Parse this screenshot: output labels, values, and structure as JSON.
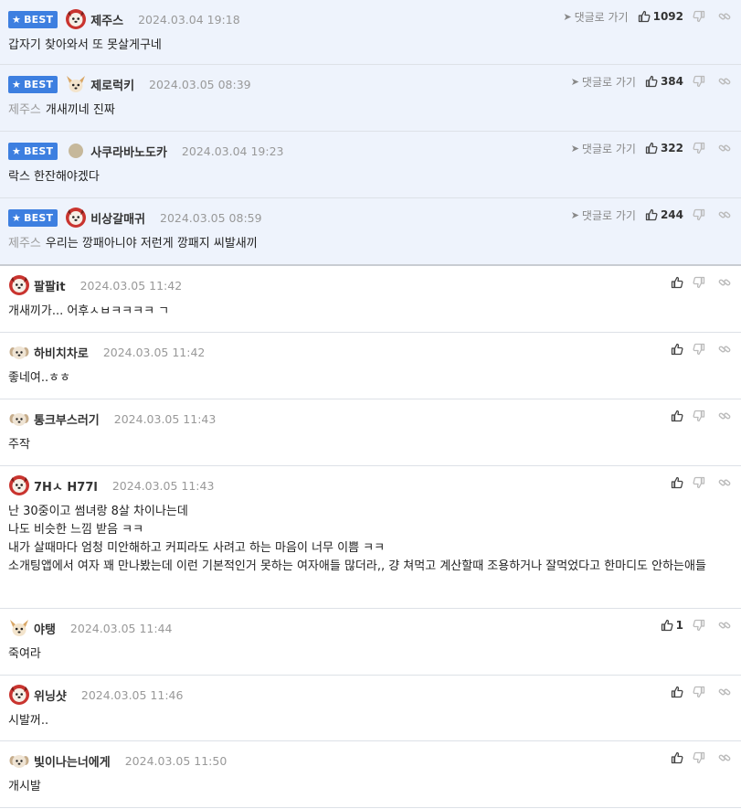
{
  "badge_label": "BEST",
  "reply_label": "댓글로 가기",
  "accent_color": "#3d7fe0",
  "comments": [
    {
      "best": true,
      "nick": "제주스",
      "date": "2024.03.04 19:18",
      "likes": "1092",
      "mention": "",
      "lines": [
        "갑자기 찾아와서 또 못살게구네"
      ],
      "avatar": "red-dog"
    },
    {
      "best": true,
      "nick": "제로럭키",
      "date": "2024.03.05 08:39",
      "likes": "384",
      "mention": "제주스",
      "lines": [
        "개새끼네 진짜"
      ],
      "avatar": "chihuahua"
    },
    {
      "best": true,
      "nick": "사쿠라바노도카",
      "date": "2024.03.04 19:23",
      "likes": "322",
      "mention": "",
      "lines": [
        "락스 한잔해야겠다"
      ],
      "avatar": "dot"
    },
    {
      "best": true,
      "nick": "비상갈매귀",
      "date": "2024.03.05 08:59",
      "likes": "244",
      "mention": "제주스",
      "lines": [
        "우리는 깡패아니야 저런게 깡패지 씨발새끼"
      ],
      "avatar": "red-dog"
    },
    {
      "best": false,
      "nick": "팔팔it",
      "date": "2024.03.05 11:42",
      "likes": "",
      "mention": "",
      "lines": [
        "개새끼가... 어후ㅅㅂㅋㅋㅋㅋ ㄱ"
      ],
      "avatar": "red-dog"
    },
    {
      "best": false,
      "nick": "하비치차로",
      "date": "2024.03.05 11:42",
      "likes": "",
      "mention": "",
      "lines": [
        "좋네여..ㅎㅎ"
      ],
      "avatar": "puppy"
    },
    {
      "best": false,
      "nick": "통크부스러기",
      "date": "2024.03.05 11:43",
      "likes": "",
      "mention": "",
      "lines": [
        "주작"
      ],
      "avatar": "puppy"
    },
    {
      "best": false,
      "nick": "7Hㅅ H77l",
      "date": "2024.03.05 11:43",
      "likes": "",
      "mention": "",
      "lines": [
        "난 30중이고 썸녀랑 8살 차이나는데",
        "나도 비슷한 느낌 받음 ㅋㅋ",
        "내가 살때마다 엄청 미안해하고 커피라도 사려고 하는 마음이 너무 이쁨 ㅋㅋ",
        "소개팅앱에서 여자 꽤 만나봤는데 이런 기본적인거 못하는 여자애들 많더라,, 걍 쳐먹고 계산할때 조용하거나 잘먹었다고 한마디도 안하는애들"
      ],
      "avatar": "red-dog"
    },
    {
      "best": false,
      "nick": "야탱",
      "date": "2024.03.05 11:44",
      "likes": "1",
      "mention": "",
      "lines": [
        "죽여라"
      ],
      "avatar": "chihuahua"
    },
    {
      "best": false,
      "nick": "위닝샷",
      "date": "2024.03.05 11:46",
      "likes": "",
      "mention": "",
      "lines": [
        "시발꺼.."
      ],
      "avatar": "red-dog"
    },
    {
      "best": false,
      "nick": "빛이나는너에게",
      "date": "2024.03.05 11:50",
      "likes": "",
      "mention": "",
      "lines": [
        "개시발"
      ],
      "avatar": "puppy"
    }
  ]
}
